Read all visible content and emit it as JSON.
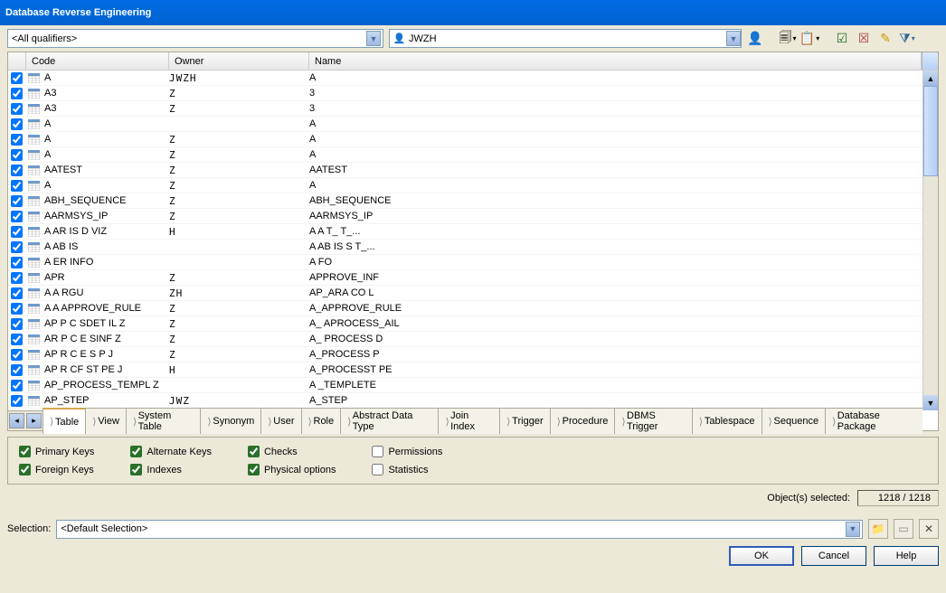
{
  "title": "Database Reverse Engineering",
  "toolbar": {
    "qualifier_selected": "<All qualifiers>",
    "user_selected": "JWZH"
  },
  "grid": {
    "columns": [
      "Code",
      "Owner",
      "Name"
    ],
    "rows": [
      {
        "chk": true,
        "code": "A",
        "owner": "JWZH",
        "name": "A"
      },
      {
        "chk": true,
        "code": "A3",
        "owner": "Z",
        "name": "3"
      },
      {
        "chk": true,
        "code": "A3",
        "owner": "Z",
        "name": "3"
      },
      {
        "chk": true,
        "code": "A",
        "owner": "",
        "name": "A"
      },
      {
        "chk": true,
        "code": "A",
        "owner": "Z",
        "name": "A"
      },
      {
        "chk": true,
        "code": "A",
        "owner": "Z",
        "name": "A"
      },
      {
        "chk": true,
        "code": "AATEST",
        "owner": "Z",
        "name": "AATEST"
      },
      {
        "chk": true,
        "code": "A",
        "owner": "Z",
        "name": "A"
      },
      {
        "chk": true,
        "code": "ABH_SEQUENCE",
        "owner": "Z",
        "name": "ABH_SEQUENCE"
      },
      {
        "chk": true,
        "code": "AARMSYS_IP",
        "owner": "Z",
        "name": "AARMSYS_IP"
      },
      {
        "chk": true,
        "code": "A AR IS D VIZ",
        "owner": "H",
        "name": "A A T_ T_..."
      },
      {
        "chk": true,
        "code": "A AB IS ",
        "owner": "",
        "name": "A AB IS S  T_..."
      },
      {
        "chk": true,
        "code": "A ER INFO",
        "owner": "",
        "name": "A    FO"
      },
      {
        "chk": true,
        "code": "APR",
        "owner": "Z",
        "name": "APPROVE_INF"
      },
      {
        "chk": true,
        "code": "A  A   RGU",
        "owner": "ZH",
        "name": "AP_ARA CO   L"
      },
      {
        "chk": true,
        "code": "A A APPROVE_RULE",
        "owner": "Z",
        "name": "A_APPROVE_RULE"
      },
      {
        "chk": true,
        "code": "AP P C  SDET IL  Z",
        "owner": "Z",
        "name": "A_ APROCESS_AIL"
      },
      {
        "chk": true,
        "code": "AR P C  E SINF  Z",
        "owner": "Z",
        "name": "A_ PROCESS D"
      },
      {
        "chk": true,
        "code": "AP R C E S P  J",
        "owner": "Z",
        "name": "A_PROCESS P"
      },
      {
        "chk": true,
        "code": "AP R CF ST PE  J",
        "owner": "H",
        "name": "A_PROCESST PE"
      },
      {
        "chk": true,
        "code": "AP_PROCESS_TEMPL  Z",
        "owner": "",
        "name": "A  _TEMPLETE"
      },
      {
        "chk": true,
        "code": "AP_STEP",
        "owner": "JWZ",
        "name": "A_STEP"
      }
    ]
  },
  "tabs": [
    "Table",
    "View",
    "System Table",
    "Synonym",
    "User",
    "Role",
    "Abstract Data Type",
    "Join Index",
    "Trigger",
    "Procedure",
    "DBMS Trigger",
    "Tablespace",
    "Sequence",
    "Database Package"
  ],
  "options": {
    "primary_keys": "Primary Keys",
    "foreign_keys": "Foreign Keys",
    "alternate_keys": "Alternate Keys",
    "indexes": "Indexes",
    "checks": "Checks",
    "physical_options": "Physical options",
    "permissions": "Permissions",
    "statistics": "Statistics"
  },
  "status": {
    "label": "Object(s) selected:",
    "value": "1218 / 1218"
  },
  "selection": {
    "label": "Selection:",
    "value": "<Default Selection>"
  },
  "buttons": {
    "ok": "OK",
    "cancel": "Cancel",
    "help": "Help"
  }
}
